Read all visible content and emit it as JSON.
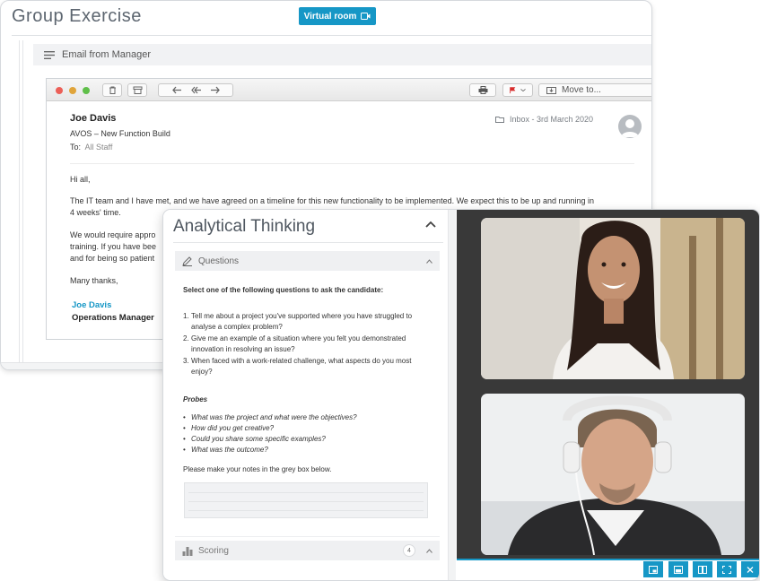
{
  "group_exercise": {
    "title": "Group Exercise",
    "virtual_room_label": "Virtual room",
    "email_bar_label": "Email from Manager"
  },
  "mail": {
    "toolbar": {
      "move_to_label": "Move to..."
    },
    "sender": "Joe Davis",
    "subject": "AVOS – New Function Build",
    "to_label": "To:",
    "to_value": "All Staff",
    "inbox_date": "Inbox - 3rd March 2020",
    "greeting": "Hi all,",
    "para1": "The IT team and I have met, and we have agreed on a timeline for this new functionality to be implemented. We expect this to be up and running in 4 weeks' time.",
    "para2_line1": "We would require appro",
    "para2_line2": "training. If you have bee",
    "para2_line3": "and for being so patient",
    "closing": "Many thanks,",
    "signature_name": "Joe Davis",
    "signature_role": "Operations Manager"
  },
  "analytical": {
    "title": "Analytical Thinking",
    "questions_label": "Questions",
    "instruction": "Select one of the following questions to ask the candidate:",
    "questions": [
      {
        "num": "1.",
        "text": "Tell me about a project you've supported where you have struggled to analyse a complex problem?"
      },
      {
        "num": "2.",
        "text": "Give me an example of a situation where you felt you demonstrated innovation in resolving an issue?"
      },
      {
        "num": "3.",
        "text": "When faced with a work-related challenge, what aspects do you most enjoy?"
      }
    ],
    "probes_title": "Probes",
    "probes": [
      "What was the project and what were the objectives?",
      "How did you get creative?",
      "Could you share some specific examples?",
      "What was the outcome?"
    ],
    "notes_label": "Please make your notes in the grey box below.",
    "scoring_label": "Scoring",
    "scoring_badge": "4"
  },
  "icons": {
    "video_camera": "video-camera-icon",
    "menu": "menu-lines-icon",
    "pencil": "pencil-icon",
    "scoring": "bar-chart-icon"
  },
  "colors": {
    "accent": "#1697c6",
    "video_bg": "#393939"
  }
}
